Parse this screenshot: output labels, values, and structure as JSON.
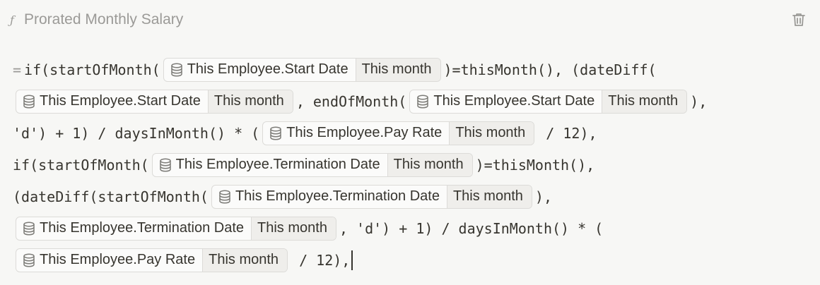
{
  "header": {
    "icon": "function-icon",
    "title": "Prorated Monthly Salary",
    "delete_icon": "trash-icon"
  },
  "formula": {
    "lines": [
      [
        {
          "t": "eq",
          "v": "="
        },
        {
          "t": "code",
          "v": "if(startOfMonth("
        },
        {
          "t": "token",
          "prop": "This Employee.Start Date",
          "mod": "This month"
        },
        {
          "t": "code",
          "v": ")=thisMonth(), (dateDiff("
        }
      ],
      [
        {
          "t": "token",
          "prop": "This Employee.Start Date",
          "mod": "This month"
        },
        {
          "t": "code",
          "v": ", endOfMonth("
        },
        {
          "t": "token",
          "prop": "This Employee.Start Date",
          "mod": "This month"
        },
        {
          "t": "code",
          "v": "),"
        }
      ],
      [
        {
          "t": "code",
          "v": "'d') + 1) / daysInMonth() * ("
        },
        {
          "t": "token",
          "prop": "This Employee.Pay Rate",
          "mod": "This month"
        },
        {
          "t": "code",
          "v": " / 12),"
        }
      ],
      [
        {
          "t": "code",
          "v": "if(startOfMonth("
        },
        {
          "t": "token",
          "prop": "This Employee.Termination Date",
          "mod": "This month"
        },
        {
          "t": "code",
          "v": ")=thisMonth(),"
        }
      ],
      [
        {
          "t": "code",
          "v": "(dateDiff(startOfMonth("
        },
        {
          "t": "token",
          "prop": "This Employee.Termination Date",
          "mod": "This month"
        },
        {
          "t": "code",
          "v": "),"
        }
      ],
      [
        {
          "t": "token",
          "prop": "This Employee.Termination Date",
          "mod": "This month"
        },
        {
          "t": "code",
          "v": ", 'd') + 1) / daysInMonth() * ("
        }
      ],
      [
        {
          "t": "token",
          "prop": "This Employee.Pay Rate",
          "mod": "This month"
        },
        {
          "t": "code",
          "v": " / 12),"
        },
        {
          "t": "cursor"
        }
      ]
    ]
  }
}
